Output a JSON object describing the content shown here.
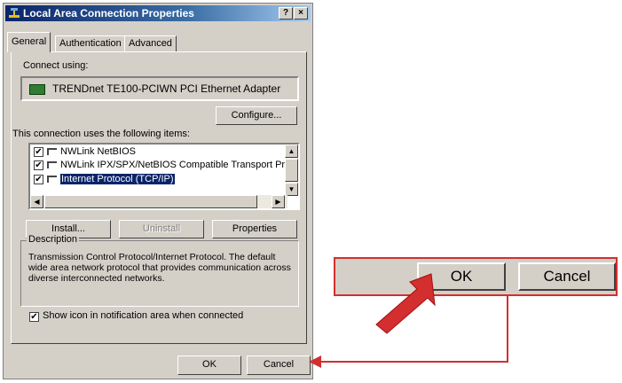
{
  "window": {
    "title": "Local Area Connection Properties",
    "help_label": "?",
    "close_label": "×"
  },
  "tabs": [
    {
      "label": "General",
      "active": true
    },
    {
      "label": "Authentication",
      "active": false
    },
    {
      "label": "Advanced",
      "active": false
    }
  ],
  "general": {
    "connect_using_label": "Connect using:",
    "adapter_name": "TRENDnet TE100-PCIWN PCI Ethernet Adapter",
    "configure_label": "Configure...",
    "items_label": "This connection uses the following items:",
    "items": [
      {
        "label": "NWLink NetBIOS",
        "checked": true,
        "selected": false
      },
      {
        "label": "NWLink IPX/SPX/NetBIOS Compatible Transport Proto",
        "checked": true,
        "selected": false
      },
      {
        "label": "Internet Protocol (TCP/IP)",
        "checked": true,
        "selected": true
      }
    ],
    "install_label": "Install...",
    "uninstall_label": "Uninstall",
    "properties_label": "Properties",
    "description_title": "Description",
    "description_text": "Transmission Control Protocol/Internet Protocol. The default wide area network protocol that provides communication across diverse interconnected networks.",
    "show_icon_label": "Show icon in notification area when connected",
    "show_icon_checked": true
  },
  "footer": {
    "ok_label": "OK",
    "cancel_label": "Cancel"
  },
  "callout": {
    "ok_label": "OK",
    "cancel_label": "Cancel",
    "accent_color": "#d32f2f"
  }
}
